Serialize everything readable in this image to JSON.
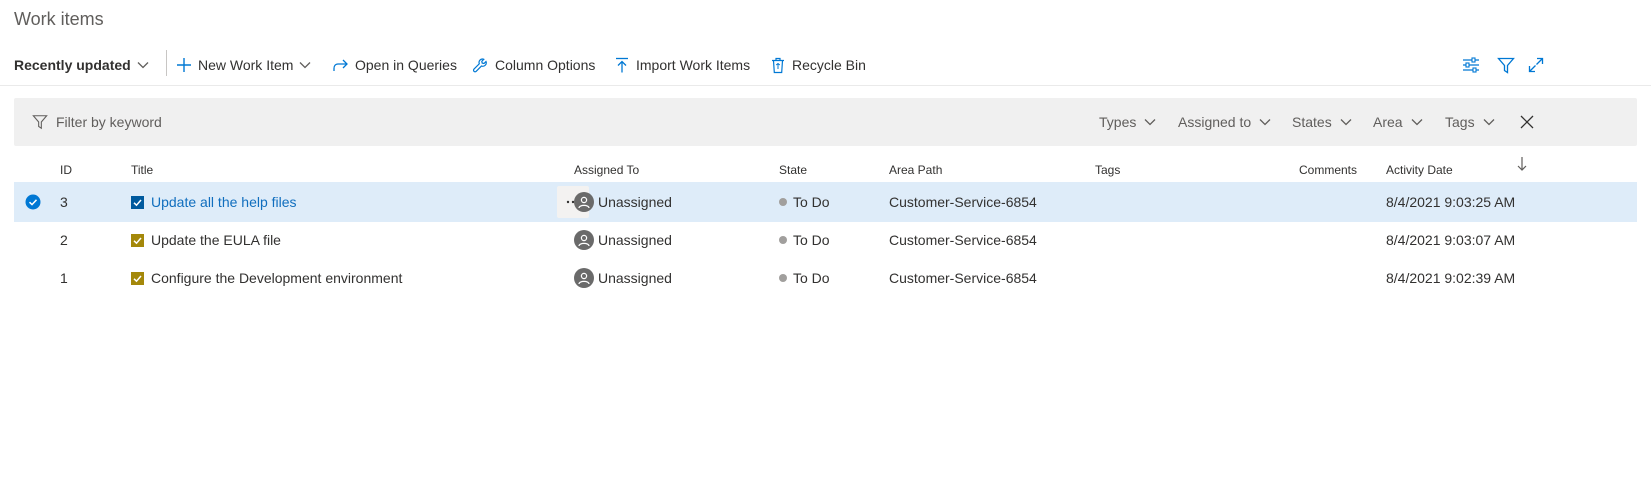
{
  "page": {
    "title": "Work items"
  },
  "toolbar": {
    "view_selector": "Recently updated",
    "new_work_item": "New Work Item",
    "open_in_queries": "Open in Queries",
    "column_options": "Column Options",
    "import_work_items": "Import Work Items",
    "recycle_bin": "Recycle Bin"
  },
  "filter": {
    "placeholder": "Filter by keyword",
    "pills": [
      "Types",
      "Assigned to",
      "States",
      "Area",
      "Tags"
    ]
  },
  "columns": {
    "id": "ID",
    "title": "Title",
    "assigned_to": "Assigned To",
    "state": "State",
    "area_path": "Area Path",
    "tags": "Tags",
    "comments": "Comments",
    "activity_date": "Activity Date"
  },
  "rows": [
    {
      "id": "3",
      "title": "Update all the help files",
      "assigned_to": "Unassigned",
      "state": "To Do",
      "area_path": "Customer-Service-6854",
      "tags": "",
      "comments": "",
      "activity_date": "8/4/2021 9:03:25 AM",
      "selected": true
    },
    {
      "id": "2",
      "title": "Update the EULA file",
      "assigned_to": "Unassigned",
      "state": "To Do",
      "area_path": "Customer-Service-6854",
      "tags": "",
      "comments": "",
      "activity_date": "8/4/2021 9:03:07 AM",
      "selected": false
    },
    {
      "id": "1",
      "title": "Configure the Development environment",
      "assigned_to": "Unassigned",
      "state": "To Do",
      "area_path": "Customer-Service-6854",
      "tags": "",
      "comments": "",
      "activity_date": "8/4/2021 9:02:39 AM",
      "selected": false
    }
  ],
  "colors": {
    "accent": "#0078d4",
    "link": "#106ebe",
    "selected_row": "#deecf9",
    "task_icon": "#a4880a",
    "task_icon_selected": "#005a9e",
    "state_todo": "#a19f9d"
  },
  "icons": {
    "view_chevron": "chevron-down-icon",
    "new": "plus-icon",
    "open_queries": "redo-arrow-icon",
    "column_options": "wrench-icon",
    "import": "upload-icon",
    "recycle": "recycle-bin-icon",
    "settings": "view-options-icon",
    "filter": "filter-icon",
    "fullscreen": "expand-icon",
    "sort": "sort-descending-icon"
  }
}
